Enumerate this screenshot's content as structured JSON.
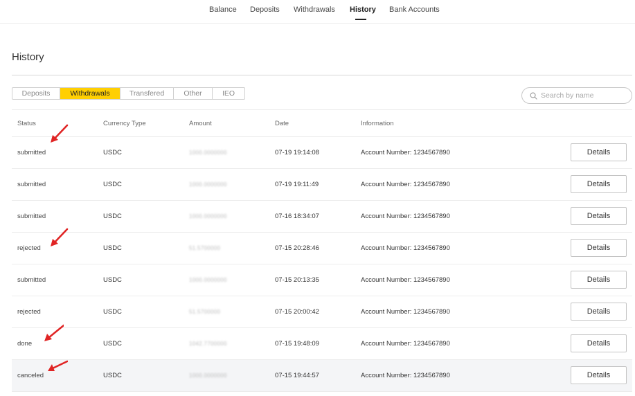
{
  "topnav": {
    "items": [
      {
        "label": "Balance",
        "active": false
      },
      {
        "label": "Deposits",
        "active": false
      },
      {
        "label": "Withdrawals",
        "active": false
      },
      {
        "label": "History",
        "active": true
      },
      {
        "label": "Bank Accounts",
        "active": false
      }
    ]
  },
  "page": {
    "title": "History"
  },
  "subtabs": [
    {
      "label": "Deposits",
      "active": false
    },
    {
      "label": "Withdrawals",
      "active": true
    },
    {
      "label": "Transfered",
      "active": false
    },
    {
      "label": "Other",
      "active": false
    },
    {
      "label": "IEO",
      "active": false
    }
  ],
  "search": {
    "placeholder": "Search by name",
    "value": "",
    "icon": "search-icon"
  },
  "table": {
    "headers": {
      "status": "Status",
      "currency": "Currency Type",
      "amount": "Amount",
      "date": "Date",
      "info": "Information"
    },
    "rows": [
      {
        "status": "submitted",
        "currency": "USDC",
        "amount": "1000.0000000",
        "date": "07-19 19:14:08",
        "info": "Account Number: 1234567890",
        "action": "Details",
        "annotated": true
      },
      {
        "status": "submitted",
        "currency": "USDC",
        "amount": "1000.0000000",
        "date": "07-19 19:11:49",
        "info": "Account Number: 1234567890",
        "action": "Details",
        "annotated": false
      },
      {
        "status": "submitted",
        "currency": "USDC",
        "amount": "1000.0000000",
        "date": "07-16 18:34:07",
        "info": "Account Number: 1234567890",
        "action": "Details",
        "annotated": false
      },
      {
        "status": "rejected",
        "currency": "USDC",
        "amount": "51.5700000",
        "date": "07-15 20:28:46",
        "info": "Account Number: 1234567890",
        "action": "Details",
        "annotated": true
      },
      {
        "status": "submitted",
        "currency": "USDC",
        "amount": "1000.0000000",
        "date": "07-15 20:13:35",
        "info": "Account Number: 1234567890",
        "action": "Details",
        "annotated": false
      },
      {
        "status": "rejected",
        "currency": "USDC",
        "amount": "51.5700000",
        "date": "07-15 20:00:42",
        "info": "Account Number: 1234567890",
        "action": "Details",
        "annotated": false
      },
      {
        "status": "done",
        "currency": "USDC",
        "amount": "1042.7700000",
        "date": "07-15 19:48:09",
        "info": "Account Number: 1234567890",
        "action": "Details",
        "annotated": true
      },
      {
        "status": "canceled",
        "currency": "USDC",
        "amount": "1000.0000000",
        "date": "07-15 19:44:57",
        "info": "Account Number: 1234567890",
        "action": "Details",
        "annotated": true,
        "hover": true
      }
    ]
  },
  "colors": {
    "accent": "#ffcf02",
    "annotation_arrow": "#e02424",
    "hover_row": "#f4f5f7"
  }
}
